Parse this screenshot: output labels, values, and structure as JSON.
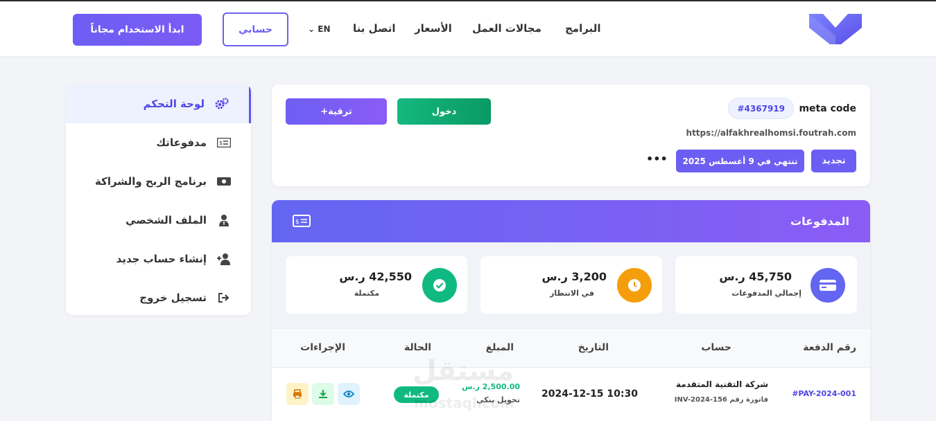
{
  "header": {
    "nav": [
      "البرامج",
      "مجالات العمل",
      "الأسعار",
      "اتصل بنا"
    ],
    "lang": "EN",
    "account_label": "حسابي",
    "start_label": "ابدأ الاستخدام مجاناً"
  },
  "sidebar": {
    "items": [
      {
        "label": "لوحة التحكم",
        "icon": "gears-icon"
      },
      {
        "label": "مدفوعاتك",
        "icon": "money-bill-icon"
      },
      {
        "label": "برنامج الربح والشراكة",
        "icon": "cash-icon"
      },
      {
        "label": "الملف الشخصي",
        "icon": "user-tie-icon"
      },
      {
        "label": "إنشاء حساب جديد",
        "icon": "user-plus-icon"
      },
      {
        "label": "تسجيل خروج",
        "icon": "sign-out-icon"
      }
    ]
  },
  "site": {
    "name": "meta code",
    "id": "#4367919",
    "url": "https://alfakhrealhomsi.foutrah.com",
    "renew_label": "تجديد",
    "expiry_label": "تنتهي في 9 أغسطس 2025",
    "more_label": "•••",
    "login_label": "دخول",
    "upgrade_label": "+ترقية"
  },
  "payments": {
    "title": "المدفوعات",
    "stats": [
      {
        "value": "45,750 ر.س",
        "label": "إجمالي المدفوعات",
        "color": "#6366f1",
        "icon": "credit-card-icon"
      },
      {
        "value": "3,200 ر.س",
        "label": "في الانتظار",
        "color": "#f59e0b",
        "icon": "clock-icon"
      },
      {
        "value": "42,550 ر.س",
        "label": "مكتملة",
        "color": "#10b981",
        "icon": "check-circle-icon"
      }
    ],
    "columns": [
      "رقم الدفعة",
      "حساب",
      "التاريخ",
      "المبلغ",
      "الحالة",
      "الإجراءات"
    ],
    "rows": [
      {
        "id": "#PAY-2024-001",
        "account": "شركة التقنية المتقدمة",
        "invoice": "فاتورة رقم INV-2024-156",
        "date": "2024-12-15 10:30",
        "amount": "2,500.00 ر.س",
        "method": "تحويل بنكي",
        "status": "مكتملة"
      }
    ]
  },
  "watermark": {
    "text": "مستقل",
    "sub": "mostaql.com"
  }
}
